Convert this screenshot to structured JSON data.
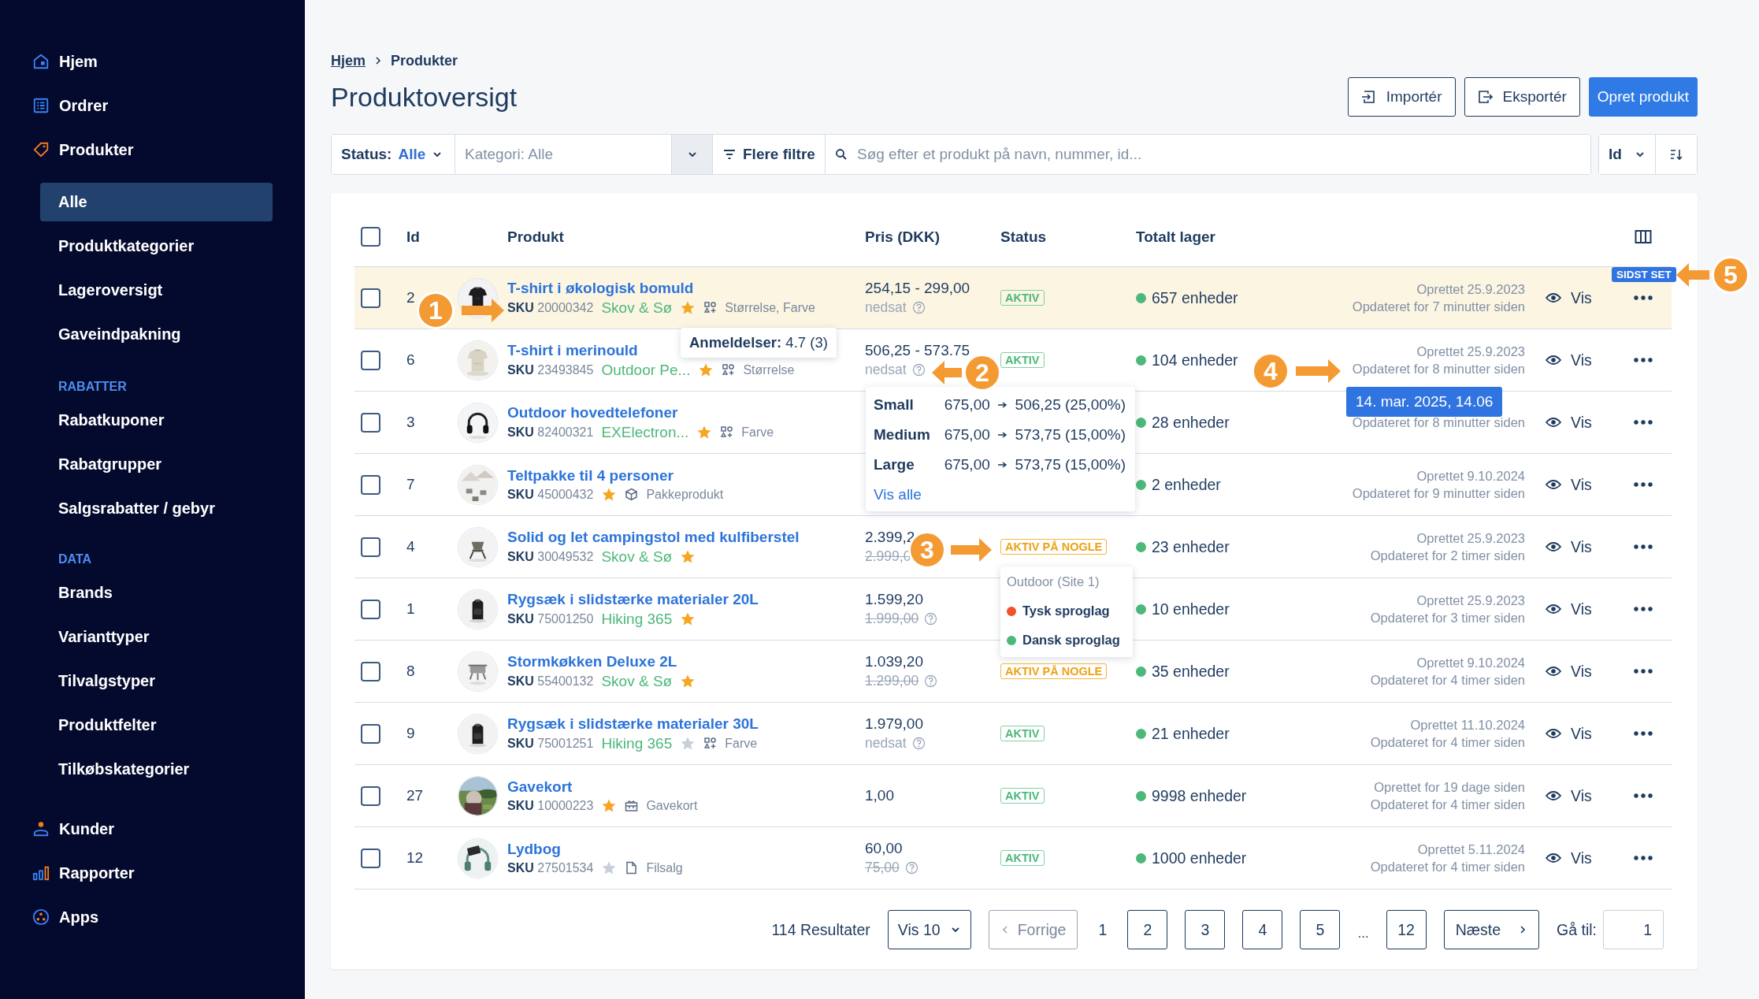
{
  "sidebar": {
    "items": [
      {
        "kind": "main",
        "label": "Hjem",
        "selected": false
      },
      {
        "kind": "main",
        "label": "Ordrer",
        "selected": false
      },
      {
        "kind": "main",
        "label": "Produkter",
        "selected": true
      },
      {
        "kind": "sub",
        "label": "Alle",
        "selected": true
      },
      {
        "kind": "sub",
        "label": "Produktkategorier",
        "selected": false
      },
      {
        "kind": "sub",
        "label": "Lageroversigt",
        "selected": false
      },
      {
        "kind": "sub",
        "label": "Gaveindpakning",
        "selected": false
      },
      {
        "kind": "section",
        "label": "RABATTER"
      },
      {
        "kind": "sub",
        "label": "Rabatkuponer",
        "selected": false
      },
      {
        "kind": "sub",
        "label": "Rabatgrupper",
        "selected": false
      },
      {
        "kind": "sub",
        "label": "Salgsrabatter / gebyr",
        "selected": false
      },
      {
        "kind": "section",
        "label": "DATA"
      },
      {
        "kind": "sub",
        "label": "Brands",
        "selected": false
      },
      {
        "kind": "sub",
        "label": "Varianttyper",
        "selected": false
      },
      {
        "kind": "sub",
        "label": "Tilvalgstyper",
        "selected": false
      },
      {
        "kind": "sub",
        "label": "Produktfelter",
        "selected": false
      },
      {
        "kind": "sub",
        "label": "Tilkøbskategorier",
        "selected": false
      },
      {
        "kind": "main",
        "label": "Kunder",
        "selected": false
      },
      {
        "kind": "main",
        "label": "Rapporter",
        "selected": false
      },
      {
        "kind": "main",
        "label": "Apps",
        "selected": false
      }
    ]
  },
  "breadcrumb": [
    {
      "label": "Hjem",
      "kind": "link"
    },
    {
      "label": "Produkter",
      "kind": "current"
    }
  ],
  "title": "Produktoversigt",
  "header_buttons": [
    {
      "label": "Importér",
      "kind": "import"
    },
    {
      "label": "Eksportér",
      "kind": "export"
    },
    {
      "label": "Opret produkt",
      "kind": "primary"
    }
  ],
  "filters": {
    "status_label": "Status:",
    "status_value": "Alle",
    "category_placeholder": "Kategori: Alle",
    "more_filters": "Flere filtre",
    "search_placeholder": "Søg efter et produkt på navn, nummer, id...",
    "sort_field": "Id"
  },
  "table": {
    "all_checked": false,
    "columns": [
      "Id",
      "Produkt",
      "Pris (DKK)",
      "Status",
      "Totalt lager"
    ],
    "rows": [
      {
        "id": "2",
        "name": "T-shirt i økologisk bomuld",
        "sku_label": "SKU",
        "sku": "20000342",
        "brand": "Skov & Sø",
        "starred": true,
        "feature": {
          "label": "Størrelse, Farve",
          "kind": "variants"
        },
        "price": "254,15 - 299,00",
        "price_note": "nedsat",
        "price_help": true,
        "status": {
          "label": "AKTIV",
          "kind": "active"
        },
        "stock": "657 enheder",
        "created": "Oprettet 25.9.2023",
        "updated": "Opdateret for 7 minutter siden",
        "view": "Vis",
        "highlighted": true,
        "checked": false
      },
      {
        "id": "6",
        "name": "T-shirt i merinould",
        "sku_label": "SKU",
        "sku": "23493845",
        "brand": "Outdoor Pe...",
        "starred": true,
        "feature": {
          "label": "Størrelse",
          "kind": "variants"
        },
        "price": "506,25 - 573.75",
        "price_note": "nedsat",
        "price_help": true,
        "status": {
          "label": "AKTIV",
          "kind": "active"
        },
        "stock": "104 enheder",
        "created": "Oprettet 25.9.2023",
        "updated": "Opdateret for 8 minutter siden",
        "view": "Vis",
        "highlighted": false,
        "checked": false
      },
      {
        "id": "3",
        "name": "Outdoor hovedtelefoner",
        "sku_label": "SKU",
        "sku": "82400321",
        "brand": "EXElectron...",
        "starred": true,
        "feature": {
          "label": "Farve",
          "kind": "variants"
        },
        "stock": "28 enheder",
        "updated": "Opdateret for 8 minutter siden",
        "view": "Vis",
        "highlighted": false,
        "checked": false
      },
      {
        "id": "7",
        "name": "Teltpakke til 4 personer",
        "sku_label": "SKU",
        "sku": "45000432",
        "starred": true,
        "feature": {
          "label": "Pakkeprodukt",
          "kind": "bundle"
        },
        "stock": "2 enheder",
        "created": "Oprettet 9.10.2024",
        "updated": "Opdateret for 9 minutter siden",
        "view": "Vis",
        "highlighted": false,
        "checked": false
      },
      {
        "id": "4",
        "name": "Solid og let campingstol med kulfiberstel",
        "sku_label": "SKU",
        "sku": "30049532",
        "brand": "Skov & Sø",
        "starred": true,
        "price": "2.399,2",
        "old_price": "2.999,0",
        "price_help": false,
        "status": {
          "label": "AKTIV PÅ NOGLE",
          "kind": "partial"
        },
        "stock": "23 enheder",
        "created": "Oprettet 25.9.2023",
        "updated": "Opdateret for 2 timer siden",
        "view": "Vis",
        "highlighted": false,
        "checked": false
      },
      {
        "id": "1",
        "name": "Rygsæk i slidstærke materialer 20L",
        "sku_label": "SKU",
        "sku": "75001250",
        "brand": "Hiking 365",
        "starred": true,
        "price": "1.599,20",
        "old_price": "1.999,00",
        "price_help": true,
        "stock": "10 enheder",
        "created": "Oprettet 25.9.2023",
        "updated": "Opdateret for 3 timer siden",
        "view": "Vis",
        "highlighted": false,
        "checked": false
      },
      {
        "id": "8",
        "name": "Stormkøkken Deluxe 2L",
        "sku_label": "SKU",
        "sku": "55400132",
        "brand": "Skov & Sø",
        "starred": true,
        "price": "1.039,20",
        "old_price": "1.299,00",
        "price_help": true,
        "status": {
          "label": "AKTIV PÅ NOGLE",
          "kind": "partial"
        },
        "stock": "35 enheder",
        "created": "Oprettet 9.10.2024",
        "updated": "Opdateret for 4 timer siden",
        "view": "Vis",
        "highlighted": false,
        "checked": false
      },
      {
        "id": "9",
        "name": "Rygsæk i slidstærke materialer 30L",
        "sku_label": "SKU",
        "sku": "75001251",
        "brand": "Hiking 365",
        "starred": false,
        "feature": {
          "label": "Farve",
          "kind": "variants"
        },
        "price": "1.979,00",
        "price_note": "nedsat",
        "price_help": true,
        "status": {
          "label": "AKTIV",
          "kind": "active"
        },
        "stock": "21 enheder",
        "created": "Oprettet 11.10.2024",
        "updated": "Opdateret for 4 timer siden",
        "view": "Vis",
        "highlighted": false,
        "checked": false
      },
      {
        "id": "27",
        "name": "Gavekort",
        "sku_label": "SKU",
        "sku": "10000223",
        "starred": true,
        "feature": {
          "label": "Gavekort",
          "kind": "giftcard"
        },
        "price": "1,00",
        "price_help": false,
        "status": {
          "label": "AKTIV",
          "kind": "active"
        },
        "stock": "9998 enheder",
        "created": "Oprettet for 19 dage siden",
        "updated": "Opdateret for 4 timer siden",
        "view": "Vis",
        "highlighted": false,
        "checked": false
      },
      {
        "id": "12",
        "name": "Lydbog",
        "sku_label": "SKU",
        "sku": "27501534",
        "starred": false,
        "feature": {
          "label": "Filsalg",
          "kind": "file"
        },
        "price": "60,00",
        "old_price": "75,00",
        "price_help": true,
        "status": {
          "label": "AKTIV",
          "kind": "active"
        },
        "stock": "1000 enheder",
        "created": "Oprettet 5.11.2024",
        "updated": "Opdateret for 4 timer siden",
        "view": "Vis",
        "highlighted": false,
        "checked": false
      }
    ]
  },
  "pagination": {
    "results": "114 Resultater",
    "per_page_label": "Vis",
    "per_page": "10",
    "previous": {
      "label": "Forrige",
      "disabled": true
    },
    "pages": [
      {
        "label": "1",
        "kind": "page",
        "selected": true
      },
      {
        "label": "2",
        "kind": "page",
        "selected": false
      },
      {
        "label": "3",
        "kind": "page",
        "selected": false
      },
      {
        "label": "4",
        "kind": "page",
        "selected": false
      },
      {
        "label": "5",
        "kind": "page",
        "selected": false
      },
      {
        "label": "...",
        "kind": "gap",
        "selected": false
      },
      {
        "label": "12",
        "kind": "page",
        "selected": false
      }
    ],
    "next": {
      "label": "Næste",
      "disabled": false
    },
    "goto_label": "Gå til:",
    "goto_value": "1"
  },
  "overlays": {
    "last_seen_badge": "SIDST SET",
    "review_tooltip": "**Anmeldelser:** 4.7 (3)",
    "price_popover": {
      "variants": [
        {
          "name": "Small",
          "old": "675,00",
          "new": "506,25 (25,00%)"
        },
        {
          "name": "Medium",
          "old": "675,00",
          "new": "573,75 (15,00%)"
        },
        {
          "name": "Large",
          "old": "675,00",
          "new": "573,75 (15,00%)"
        }
      ],
      "link": "Vis alle"
    },
    "status_dropdown": {
      "title": "Outdoor (Site 1)",
      "items": [
        {
          "label": "Tysk sproglag",
          "color": "#f0522a"
        },
        {
          "label": "Dansk sproglag",
          "color": "#4cb87a"
        }
      ]
    },
    "date_tooltip": "14. mar. 2025, 14.06",
    "callouts": [
      {
        "number": "1",
        "kind": "right"
      },
      {
        "number": "2",
        "kind": "left"
      },
      {
        "number": "3",
        "kind": "right"
      },
      {
        "number": "4",
        "kind": "right"
      },
      {
        "number": "5",
        "kind": "left"
      }
    ]
  }
}
